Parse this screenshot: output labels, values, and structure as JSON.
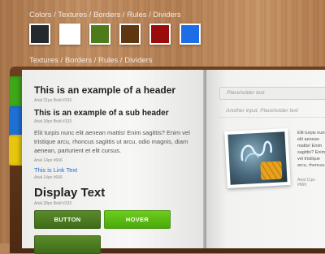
{
  "headings": {
    "top": "Colors / Textures / Borders / Rules / Dividers",
    "middle": "Textures / Borders / Rules / Dividers"
  },
  "swatches": [
    {
      "name": "dark",
      "color": "#25282c"
    },
    {
      "name": "white",
      "color": "#ffffff"
    },
    {
      "name": "green",
      "color": "#4d7b1a"
    },
    {
      "name": "brown",
      "color": "#5e360f"
    },
    {
      "name": "red",
      "color": "#9a0b0b"
    },
    {
      "name": "blue",
      "color": "#1d6de6"
    }
  ],
  "tabs": [
    {
      "name": "green",
      "color": "#3ea71a"
    },
    {
      "name": "blue",
      "color": "#1f6fd6"
    },
    {
      "name": "yellow",
      "color": "#e6c70d"
    }
  ],
  "left_page": {
    "header": "This is an example of a header",
    "header_meta": "Arial 21px Bold #333",
    "subheader": "This is an example of a sub header",
    "subheader_meta": "Arial 18px Bold #333",
    "paragraph": "Elit turpis nunc elit aenean mattis! Enim sagittis? Enim vel tristique arcu, rhoncus sagittis ut arcu, odio magnis, diam aenean, parturient et elit cursus.",
    "paragraph_meta": "Arial 14px #666",
    "link": "This is Link Text",
    "link_meta": "Arial 14px #666",
    "display": "Display Text",
    "display_meta": "Arial 28px Bold #333",
    "button_label": "BUTTON",
    "hover_label": "HOVER"
  },
  "right_page": {
    "placeholder1": "Placeholder text",
    "placeholder2": "Another input. Placeholder text",
    "side_text": "Elit turpis nunc elit aenean mattis! Enim sagittis? Enim vel tristique arcu, rhoncus",
    "side_meta": "Arial 11px #666"
  }
}
